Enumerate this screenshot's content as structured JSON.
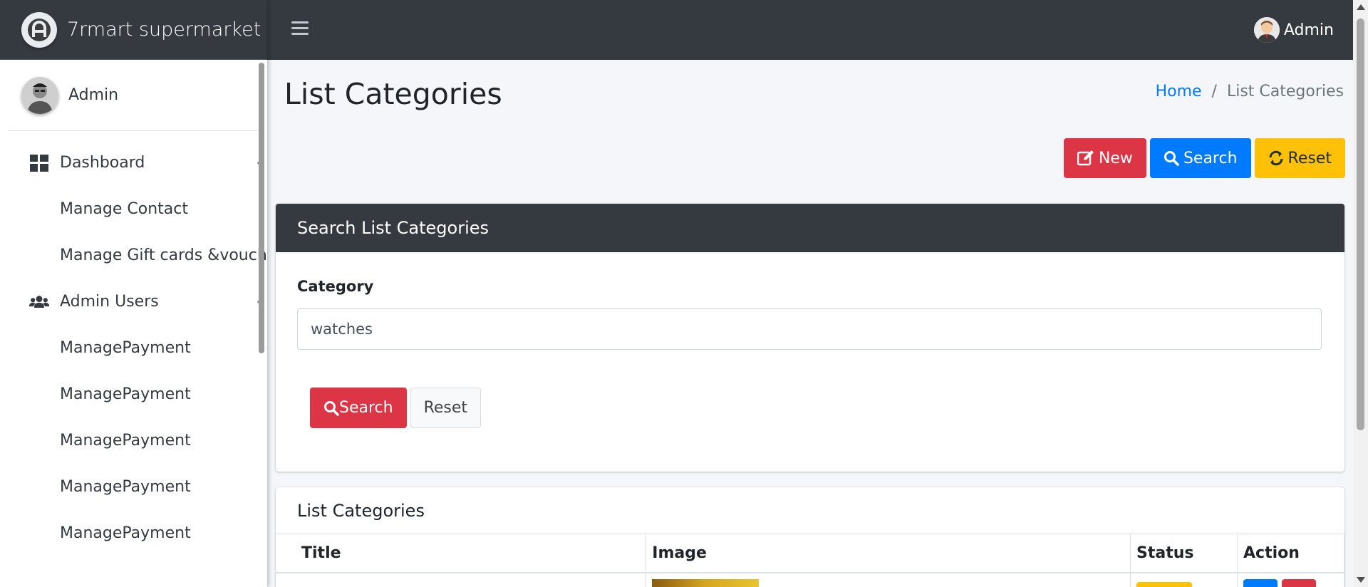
{
  "app": {
    "brand_name": "7rmart supermarket"
  },
  "sidebar": {
    "user_name": "Admin",
    "items": [
      {
        "label": "Dashboard",
        "icon": "dashboard-grid-icon",
        "has_children": true
      },
      {
        "label": "Manage Contact",
        "icon": null,
        "has_children": false
      },
      {
        "label": "Manage Gift cards &voucher",
        "icon": null,
        "has_children": false
      },
      {
        "label": "Admin Users",
        "icon": "users-icon",
        "has_children": true
      },
      {
        "label": "ManagePayment",
        "icon": null,
        "has_children": false
      },
      {
        "label": "ManagePayment",
        "icon": null,
        "has_children": false
      },
      {
        "label": "ManagePayment",
        "icon": null,
        "has_children": false
      },
      {
        "label": "ManagePayment",
        "icon": null,
        "has_children": false
      },
      {
        "label": "ManagePayment",
        "icon": null,
        "has_children": false
      }
    ]
  },
  "topbar": {
    "menu_icon": "hamburger-menu-icon",
    "user_name": "Admin"
  },
  "page": {
    "title": "List Categories",
    "breadcrumb": {
      "home": "Home",
      "separator": "/",
      "current": "List Categories"
    },
    "actions": {
      "new_label": "New",
      "search_label": "Search",
      "reset_label": "Reset"
    }
  },
  "search_card": {
    "header": "Search List Categories",
    "field_label": "Category",
    "field_value": "watches",
    "search_button": "Search",
    "reset_button": "Reset"
  },
  "list_card": {
    "header": "List Categories",
    "columns": [
      "Title",
      "Image",
      "Status",
      "Action"
    ]
  },
  "colors": {
    "dark": "#343a40",
    "danger": "#dc3545",
    "primary": "#007bff",
    "warning": "#ffc107",
    "link": "#007bff"
  }
}
